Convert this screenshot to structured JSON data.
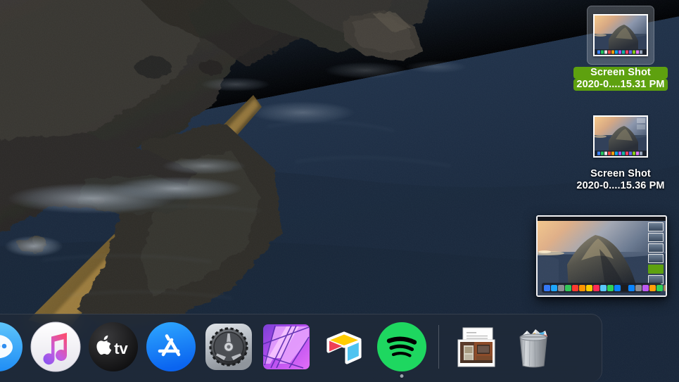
{
  "desktop": {
    "wallpaper_name": "macos-catalina-island-coast",
    "background_color": "#1c2b3d",
    "water_color": "#223449",
    "rock_color": "#3a3732",
    "highlight_color": "#5ea10f"
  },
  "icons": [
    {
      "name": "screen-shot-1",
      "line1": "Screen Shot",
      "line2": "2020-0....15.31 PM",
      "selected": true,
      "kind": "screenshot-file"
    },
    {
      "name": "screen-shot-2",
      "line1": "Screen Shot",
      "line2": "2020-0....15.36 PM",
      "selected": false,
      "kind": "screenshot-file"
    }
  ],
  "screenshot_preview": {
    "name": "screenshot-thumbnail-preview",
    "description": "floating screenshot thumbnail of the desktop",
    "dock_icon_colors": [
      "#3478f6",
      "#1ea7fd",
      "#8e8e93",
      "#34c759",
      "#ff3b30",
      "#ff9500",
      "#ffcc00",
      "#ff2d55",
      "#5ac8fa",
      "#30d158",
      "#0a84ff",
      "#1c1c1e",
      "#0b84ff",
      "#8e8e93",
      "#bf5af2",
      "#ff9f0a",
      "#30d158",
      "#a2845e",
      "#c7c7cc"
    ],
    "desktop_icon_count": 6,
    "selected_icon_index": 4
  },
  "dock": {
    "background_color": "#1f2938",
    "items": [
      {
        "name": "dock-item-messages",
        "label": "Messages",
        "icon": "messages-icon",
        "running": false
      },
      {
        "name": "dock-item-music",
        "label": "Music",
        "icon": "music-icon",
        "running": false
      },
      {
        "name": "dock-item-apple-tv",
        "label": "TV",
        "icon": "apple-tv-icon",
        "running": false
      },
      {
        "name": "dock-item-app-store",
        "label": "App Store",
        "icon": "app-store-icon",
        "running": false
      },
      {
        "name": "dock-item-system-preferences",
        "label": "System Preferences",
        "icon": "system-preferences-icon",
        "running": false
      },
      {
        "name": "dock-item-affinity-photo",
        "label": "Affinity Photo",
        "icon": "affinity-photo-icon",
        "running": false
      },
      {
        "name": "dock-item-airtable",
        "label": "Airtable",
        "icon": "airtable-icon",
        "running": false
      },
      {
        "name": "dock-item-spotify",
        "label": "Spotify",
        "icon": "spotify-icon",
        "running": true
      }
    ],
    "right_items": [
      {
        "name": "dock-item-downloads-stack",
        "label": "Downloads",
        "icon": "documents-stack-icon"
      },
      {
        "name": "dock-item-trash",
        "label": "Trash",
        "icon": "trash-full-icon"
      }
    ]
  }
}
